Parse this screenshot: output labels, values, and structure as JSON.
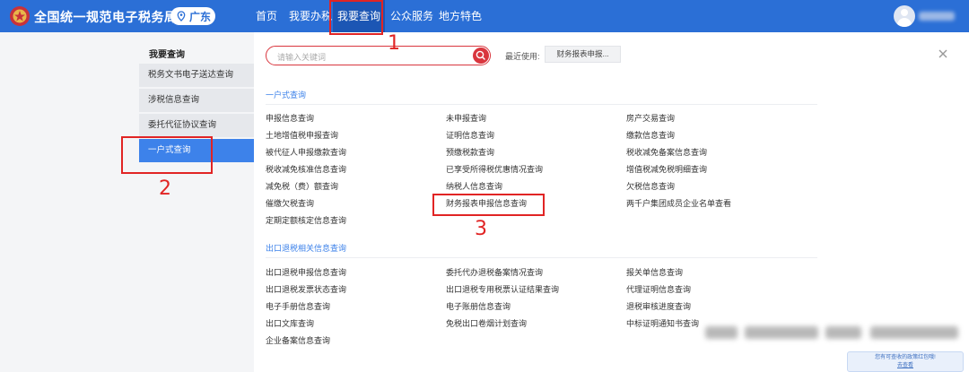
{
  "header": {
    "brand": "全国统一规范电子税务局",
    "region": "广东",
    "nav": [
      "首页",
      "我要办税",
      "我要查询",
      "公众服务",
      "地方特色"
    ],
    "active_nav": "我要查询",
    "colors": {
      "primary": "#2b6fd6",
      "active": "#1c56b4",
      "highlight": "#e12424"
    }
  },
  "sidebar": {
    "title": "我要查询",
    "items": [
      "税务文书电子送达查询",
      "涉税信息查询",
      "委托代征协议查询",
      "一户式查询"
    ]
  },
  "search": {
    "placeholder": "请输入关键词"
  },
  "recent": {
    "label": "最近使用:",
    "tag": "财务报表申报..."
  },
  "sections": {
    "s1": {
      "title": "一户式查询",
      "col1": [
        "申报信息查询",
        "土地增值税申报查询",
        "被代征人申报缴款查询",
        "税收减免核准信息查询",
        "减免税（费）额查询",
        "催缴欠税查询",
        "定期定额核定信息查询"
      ],
      "col2": [
        "未申报查询",
        "证明信息查询",
        "预缴税款查询",
        "已享受所得税优惠情况查询",
        "纳税人信息查询",
        "财务报表申报信息查询"
      ],
      "col3": [
        "房产交易查询",
        "缴款信息查询",
        "税收减免备案信息查询",
        "增值税减免税明细查询",
        "欠税信息查询",
        "两千户集团成员企业名单查看"
      ]
    },
    "s2": {
      "title": "出口退税相关信息查询",
      "col1": [
        "出口退税申报信息查询",
        "出口退税发票状态查询",
        "电子手册信息查询",
        "出口文库查询",
        "企业备案信息查询"
      ],
      "col2": [
        "委托代办退税备案情况查询",
        "出口退税专用税票认证结果查询",
        "电子账册信息查询",
        "免税出口卷烟计划查询"
      ],
      "col3": [
        "报关单信息查询",
        "代理证明信息查询",
        "退税审核进度查询",
        "中标证明通知书查询"
      ]
    }
  },
  "annotations": [
    "1",
    "2",
    "3"
  ],
  "notice": {
    "line1": "您有可查收的政策红包哦!",
    "link": "去查看"
  }
}
